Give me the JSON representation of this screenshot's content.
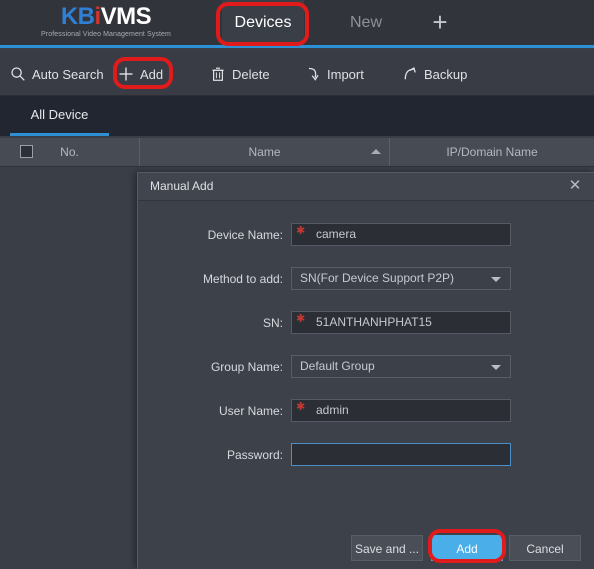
{
  "app": {
    "logo": {
      "part1": "KB",
      "part2": "i",
      "part3": "VMS",
      "subtitle": "Professional Video Management System"
    },
    "brand_blue": "#2f7fd6",
    "brand_red": "#d4342c",
    "accent_blue": "#2c91d4",
    "annotation_red": "#e01b1b"
  },
  "topbar": {
    "tabs": [
      {
        "label": "Devices",
        "active": true
      },
      {
        "label": "New",
        "active": false
      }
    ],
    "add_tab_icon": "plus-icon",
    "add_tab_label": "+"
  },
  "toolbar": {
    "items": [
      {
        "label": "Auto Search",
        "icon": "search-icon"
      },
      {
        "label": "Add",
        "icon": "plus-icon"
      },
      {
        "label": "Delete",
        "icon": "trash-icon"
      },
      {
        "label": "Import",
        "icon": "import-arrow-down-icon"
      },
      {
        "label": "Backup",
        "icon": "backup-arrow-up-icon"
      }
    ]
  },
  "subtabs": {
    "items": [
      {
        "label": "All Device",
        "active": true
      }
    ]
  },
  "table": {
    "columns": [
      {
        "label": "No.",
        "has_checkbox": true
      },
      {
        "label": "Name",
        "sorted": "asc"
      },
      {
        "label": "IP/Domain Name"
      }
    ],
    "rows": []
  },
  "dialog": {
    "title": "Manual Add",
    "close_icon": "close-icon",
    "fields": [
      {
        "label": "Device Name:",
        "type": "text",
        "value": "camera",
        "required": true,
        "focused": false
      },
      {
        "label": "Method to add:",
        "type": "select",
        "value": "SN(For Device Support P2P)",
        "required": false
      },
      {
        "label": "SN:",
        "type": "text",
        "value": "51ANTHANHPHAT15",
        "required": true,
        "focused": false
      },
      {
        "label": "Group Name:",
        "type": "select",
        "value": "Default Group",
        "required": false
      },
      {
        "label": "User Name:",
        "type": "text",
        "value": "admin",
        "required": true,
        "focused": false
      },
      {
        "label": "Password:",
        "type": "password",
        "value": "",
        "required": false,
        "focused": true
      }
    ],
    "buttons": [
      {
        "label": "Save and ...",
        "primary": false
      },
      {
        "label": "Add",
        "primary": true
      },
      {
        "label": "Cancel",
        "primary": false
      }
    ]
  },
  "annotations": [
    {
      "target": "Devices tab"
    },
    {
      "target": "Add toolbar button"
    },
    {
      "target": "Add dialog button"
    }
  ]
}
